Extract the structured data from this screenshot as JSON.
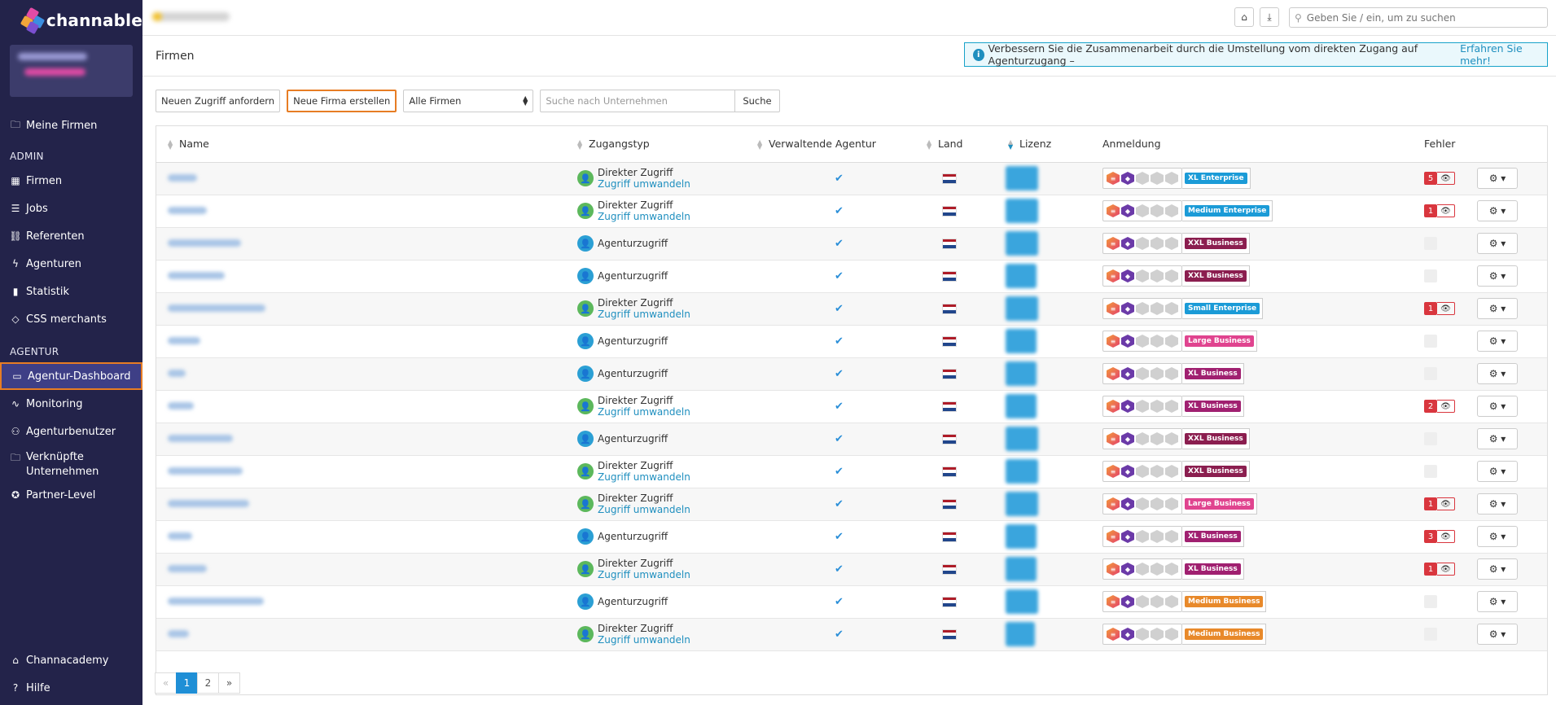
{
  "app": {
    "name": "channable"
  },
  "sidebar": {
    "top_items": [
      {
        "label": "Meine Firmen",
        "icon": "briefcase-icon"
      }
    ],
    "admin_title": "ADMIN",
    "admin_items": [
      {
        "label": "Firmen",
        "icon": "building-icon"
      },
      {
        "label": "Jobs",
        "icon": "list-icon"
      },
      {
        "label": "Referenten",
        "icon": "network-icon"
      },
      {
        "label": "Agenturen",
        "icon": "bolt-icon"
      },
      {
        "label": "Statistik",
        "icon": "bar-chart-icon"
      },
      {
        "label": "CSS merchants",
        "icon": "tag-icon"
      }
    ],
    "agency_title": "AGENTUR",
    "agency_items": [
      {
        "label": "Agentur-Dashboard",
        "icon": "monitor-icon"
      },
      {
        "label": "Monitoring",
        "icon": "pulse-icon"
      },
      {
        "label": "Agenturbenutzer",
        "icon": "users-icon"
      },
      {
        "label": "Verknüpfte Unternehmen",
        "icon": "briefcase-icon"
      },
      {
        "label": "Partner-Level",
        "icon": "award-icon"
      }
    ],
    "bottom_items": [
      {
        "label": "Channacademy",
        "icon": "graduation-cap-icon"
      },
      {
        "label": "Hilfe",
        "icon": "help-circle-icon"
      }
    ]
  },
  "topbar": {
    "search_placeholder": "Geben Sie / ein, um zu suchen"
  },
  "page": {
    "title": "Firmen",
    "banner_text": "Verbessern Sie die Zusammenarbeit durch die Umstellung vom direkten Zugang auf Agenturzugang –",
    "banner_link": "Erfahren Sie mehr!"
  },
  "toolbar": {
    "request_access": "Neuen Zugriff anfordern",
    "new_company": "Neue Firma erstellen",
    "filter_selected": "Alle Firmen",
    "search_placeholder": "Suche nach Unternehmen",
    "search_button": "Suche"
  },
  "table": {
    "headers": {
      "name": "Name",
      "access": "Zugangstyp",
      "agency": "Verwaltende Agentur",
      "country": "Land",
      "license": "Lizenz",
      "login": "Anmeldung",
      "errors": "Fehler"
    },
    "access_direct": "Direkter Zugriff",
    "access_convert": "Zugriff umwandeln",
    "access_agency": "Agenturzugriff",
    "colors": {
      "direct": "#5cb85c",
      "agency": "#2b9fd4",
      "error": "#d9363e",
      "accent": "#1f8fbf"
    },
    "rows": [
      {
        "type": "direct",
        "plan": "XL Enterprise",
        "plan_color": "#1b9bd7",
        "errors": "5"
      },
      {
        "type": "direct",
        "plan": "Medium Enterprise",
        "plan_color": "#1b9bd7",
        "errors": "1"
      },
      {
        "type": "agency",
        "plan": "XXL Business",
        "plan_color": "#8b1e4f",
        "errors": "0"
      },
      {
        "type": "agency",
        "plan": "XXL Business",
        "plan_color": "#8b1e4f",
        "errors": "0"
      },
      {
        "type": "direct",
        "plan": "Small Enterprise",
        "plan_color": "#1b9bd7",
        "errors": "1"
      },
      {
        "type": "agency",
        "plan": "Large Business",
        "plan_color": "#e0448f",
        "errors": "0"
      },
      {
        "type": "agency",
        "plan": "XL Business",
        "plan_color": "#a02070",
        "errors": "0"
      },
      {
        "type": "direct",
        "plan": "XL Business",
        "plan_color": "#a02070",
        "errors": "2"
      },
      {
        "type": "agency",
        "plan": "XXL Business",
        "plan_color": "#8b1e4f",
        "errors": "0"
      },
      {
        "type": "direct",
        "plan": "XXL Business",
        "plan_color": "#8b1e4f",
        "errors": "0"
      },
      {
        "type": "direct",
        "plan": "Large Business",
        "plan_color": "#e0448f",
        "errors": "1"
      },
      {
        "type": "agency",
        "plan": "XL Business",
        "plan_color": "#a02070",
        "errors": "3"
      },
      {
        "type": "direct",
        "plan": "XL Business",
        "plan_color": "#a02070",
        "errors": "1"
      },
      {
        "type": "agency",
        "plan": "Medium Business",
        "plan_color": "#e8892a",
        "errors": "0"
      },
      {
        "type": "direct",
        "plan": "Medium Business",
        "plan_color": "#e8892a",
        "errors": "0"
      }
    ]
  },
  "pagination": {
    "prev": "«",
    "pages": [
      "1",
      "2"
    ],
    "current": "1",
    "next": "»"
  }
}
